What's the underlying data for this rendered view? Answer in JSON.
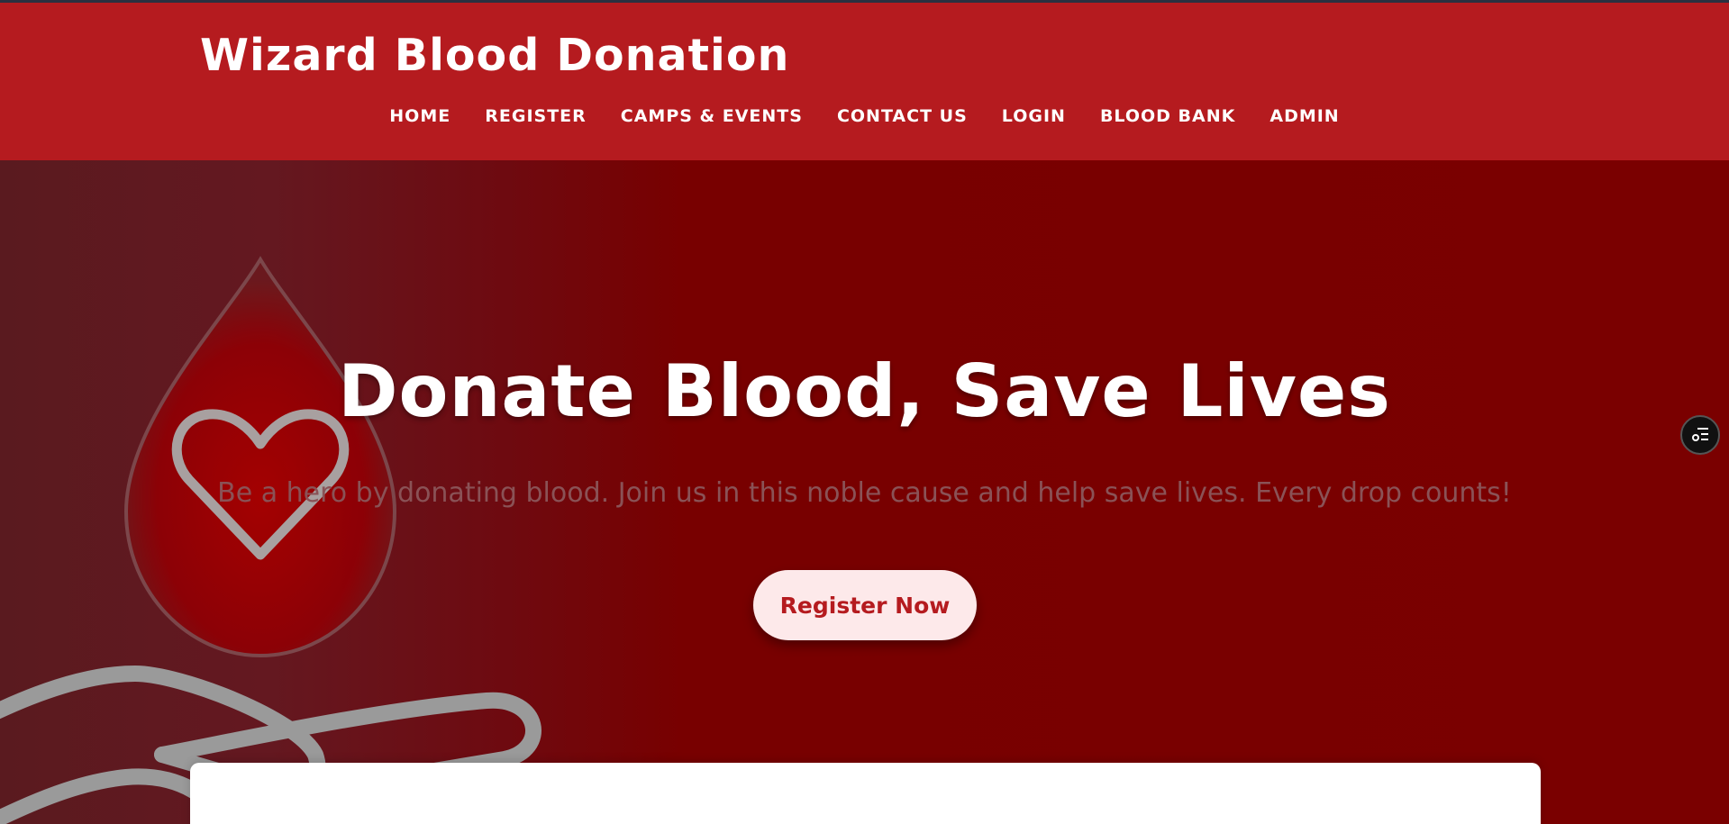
{
  "header": {
    "brand": "Wizard Blood Donation",
    "nav": [
      {
        "label": "HOME"
      },
      {
        "label": "REGISTER"
      },
      {
        "label": "CAMPS & EVENTS"
      },
      {
        "label": "CONTACT US"
      },
      {
        "label": "LOGIN"
      },
      {
        "label": "BLOOD BANK"
      },
      {
        "label": "ADMIN"
      }
    ]
  },
  "hero": {
    "title": "Donate Blood, Save Lives",
    "subtitle": "Be a hero by donating blood. Join us in this noble cause and help save lives. Every drop counts!",
    "cta_label": "Register Now",
    "illustration_icon": "blood-drop-heart-hand-icon"
  },
  "widget": {
    "icon": "accessibility-menu-icon"
  },
  "colors": {
    "header_bg": "#b51b1f",
    "hero_bg": "#7a0000",
    "cta_bg": "#fde9ea",
    "cta_text": "#b51b1f"
  }
}
